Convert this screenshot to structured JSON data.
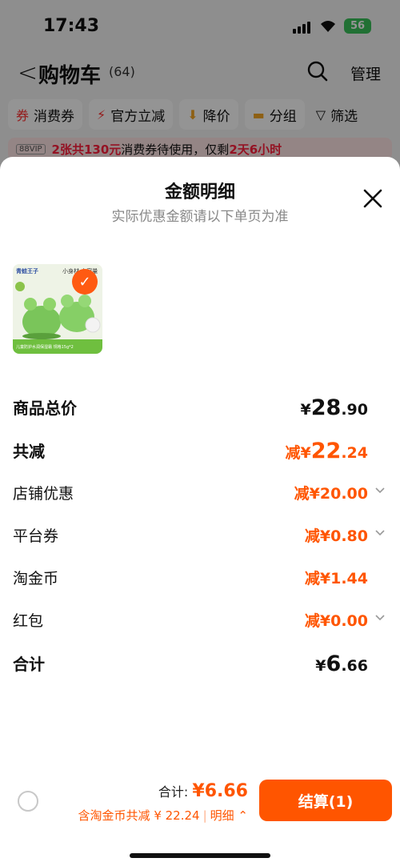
{
  "status": {
    "time": "17:43",
    "battery": "56"
  },
  "nav": {
    "back": "<",
    "title": "购物车",
    "count": "(64)",
    "manage": "管理"
  },
  "filters": [
    {
      "label": "消费券",
      "icon": "coupon-icon",
      "glyph": "券",
      "color": "#ff2d2d"
    },
    {
      "label": "官方立减",
      "icon": "lightning-icon",
      "glyph": "⚡",
      "color": "#ff2d2d"
    },
    {
      "label": "降价",
      "icon": "down-arrow-icon",
      "glyph": "⬇",
      "color": "#f5a623"
    },
    {
      "label": "分组",
      "icon": "folder-icon",
      "glyph": "▬",
      "color": "#f5a623"
    },
    {
      "label": "筛选",
      "icon": "filter-icon",
      "glyph": "▽",
      "color": "#111111"
    }
  ],
  "promo": {
    "vip": "88VIP",
    "highlight1": "2张共130元",
    "text1": "消费券待使用，仅剩",
    "highlight2": "2天6小时"
  },
  "sheet": {
    "title": "金额明细",
    "subtitle": "实际优惠金额请以下单页为准",
    "product": {
      "brand": "青蛙王子",
      "tag": "小身材 大容量",
      "caption": "儿童防护水润保湿霜 规格15g*2"
    }
  },
  "rows": {
    "total": {
      "label": "商品总价",
      "currency": "¥",
      "int": "28",
      "dec": ".90"
    },
    "reduce": {
      "label": "共减",
      "prefix": "减¥",
      "int": "22",
      "dec": ".24"
    },
    "shop": {
      "label": "店铺优惠",
      "value": "减¥20.00"
    },
    "platform": {
      "label": "平台券",
      "value": "减¥0.80"
    },
    "coin": {
      "label": "淘金币",
      "value": "减¥1.44"
    },
    "redpacket": {
      "label": "红包",
      "value": "减¥0.00"
    },
    "sum": {
      "label": "合计",
      "currency": "¥",
      "int": "6",
      "dec": ".66"
    }
  },
  "bottom": {
    "total_label": "合计:",
    "total_value": "¥6.66",
    "saved": "含淘金币共减 ¥ 22.24",
    "detail": "明细",
    "checkout": "结算(1)"
  },
  "colors": {
    "accent": "#ff5500",
    "promo_red": "#ff1f3d"
  }
}
